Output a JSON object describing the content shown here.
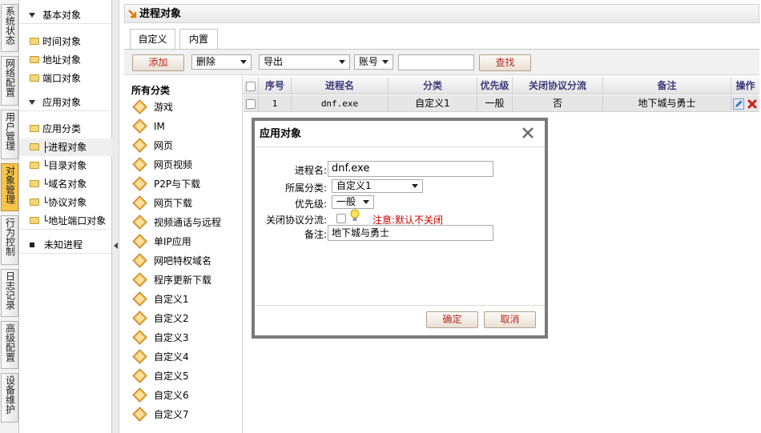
{
  "left_nav": {
    "tabs": [
      {
        "label": "系统状态"
      },
      {
        "label": "网络配置"
      },
      {
        "label": "用户管理"
      },
      {
        "label": "对象管理",
        "active": true
      },
      {
        "label": "行为控制"
      },
      {
        "label": "日志记录"
      },
      {
        "label": "高级配置"
      },
      {
        "label": "设备维护"
      }
    ]
  },
  "tree": {
    "basic_group": "基本对象",
    "time_obj": "时间对象",
    "addr_obj": "地址对象",
    "port_obj": "端口对象",
    "app_group": "应用对象",
    "app_category": "应用分类",
    "process_obj": "├进程对象",
    "dir_obj": "└目录对象",
    "domain_obj": "└域名对象",
    "protocol_obj": "└协议对象",
    "addrport_obj": "└地址端口对象",
    "unknown_process": "未知进程"
  },
  "page": {
    "title": "进程对象"
  },
  "tabs": {
    "custom": "自定义",
    "builtin": "内置"
  },
  "toolbar": {
    "add": "添加",
    "delete": "删除",
    "export": "导出",
    "account": "账号",
    "search_value": "",
    "find": "查找"
  },
  "categories": {
    "title": "所有分类",
    "items": [
      "游戏",
      "IM",
      "网页",
      "网页视频",
      "P2P与下载",
      "网页下载",
      "视频通话与远程",
      "单IP应用",
      "网吧特权域名",
      "程序更新下载",
      "自定义1",
      "自定义2",
      "自定义3",
      "自定义4",
      "自定义5",
      "自定义6",
      "自定义7"
    ]
  },
  "table": {
    "headers": {
      "seq": "序号",
      "process": "进程名",
      "category": "分类",
      "priority": "优先级",
      "close_split": "关闭协议分流",
      "remark": "备注",
      "action": "操作"
    },
    "rows": [
      {
        "seq": "1",
        "process": "dnf.exe",
        "category": "自定义1",
        "priority": "一般",
        "close_split": "否",
        "remark": "地下城与勇士"
      }
    ]
  },
  "dialog": {
    "title": "应用对象",
    "process_label": "进程名:",
    "process_value": "dnf.exe",
    "category_label": "所属分类:",
    "category_value": "自定义1",
    "priority_label": "优先级:",
    "priority_value": "一般",
    "close_split_label": "关闭协议分流:",
    "close_split_note": "注意:默认不关闭",
    "remark_label": "备注:",
    "remark_value": "地下城与勇士",
    "ok": "确定",
    "cancel": "取消"
  },
  "colors": {
    "active_tab": "#f7c54a",
    "button_text": "#b32a1a",
    "warning_text": "#cc0000",
    "header_text": "#3a3a7a",
    "dialog_border": "#7a7a7a"
  }
}
